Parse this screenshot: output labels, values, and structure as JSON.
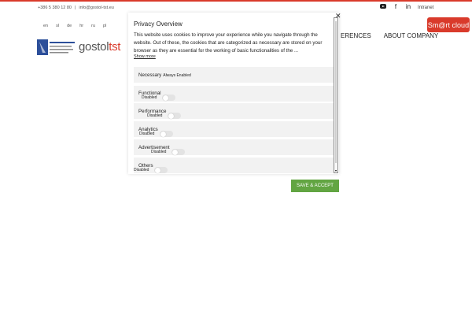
{
  "header": {
    "phone": "+386 5 380 12 80",
    "separator": "|",
    "email": "info@gostol-tst.eu",
    "intranet": "Intranet",
    "languages": [
      "en",
      "sl",
      "de",
      "hr",
      "ru",
      "pl"
    ],
    "brand_part1": "gostol",
    "brand_part2": "tst",
    "nav": [
      "erences",
      "About company"
    ],
    "smart_cloud": "Sm@rt cloud",
    "social_icons": [
      "youtube-icon",
      "facebook-icon",
      "linkedin-icon"
    ]
  },
  "modal": {
    "title": "Privacy Overview",
    "description": "This website uses cookies to improve your experience while you navigate through the website. Out of these, the cookies that are categorized as necessary are stored on your browser as they are essential for the working of basic functionalities of the ...",
    "show_more": "Show more",
    "close_glyph": "✕",
    "categories": [
      {
        "name": "Necessary",
        "status": "Always Enabled"
      },
      {
        "name": "Functional",
        "status": "Disabled"
      },
      {
        "name": "Performance",
        "status": "Disabled"
      },
      {
        "name": "Analytics",
        "status": "Disabled"
      },
      {
        "name": "Advertisement",
        "status": "Disabled"
      },
      {
        "name": "Others",
        "status": "Disabled"
      }
    ],
    "save_button": "Save & Accept"
  },
  "colors": {
    "accent": "#d93a2b",
    "save": "#62a542",
    "panel": "#f2f2f2"
  }
}
